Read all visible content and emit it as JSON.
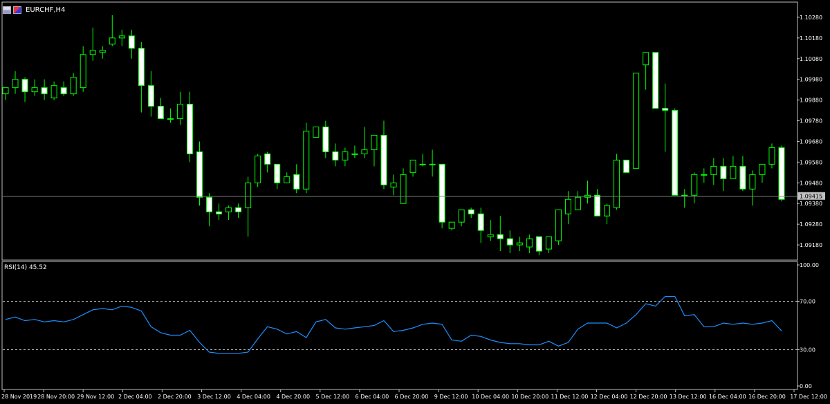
{
  "window": {
    "symbol_title": "EURCHF,H4"
  },
  "colors": {
    "background": "#000000",
    "bull_fill": "#000000",
    "bear_fill": "#ffffff",
    "wick": "#00ff00",
    "grid_border": "#c0c0c0",
    "rsi_line": "#1e90ff",
    "bid_line": "#808080"
  },
  "chart_data": [
    {
      "type": "candlestick",
      "title": "EURCHF,H4",
      "ylim": [
        1.0911,
        1.1035
      ],
      "y_ticks": [
        "1.10280",
        "1.10180",
        "1.10080",
        "1.09980",
        "1.09880",
        "1.09780",
        "1.09680",
        "1.09580",
        "1.09480",
        "1.09380",
        "1.09280",
        "1.09180"
      ],
      "current_price": "1.09415",
      "x_tick_labels": [
        "28 Nov 2019",
        "28 Nov 20:00",
        "29 Nov 12:00",
        "2 Dec 04:00",
        "2 Dec 20:00",
        "3 Dec 12:00",
        "4 Dec 04:00",
        "4 Dec 20:00",
        "5 Dec 12:00",
        "6 Dec 04:00",
        "6 Dec 20:00",
        "9 Dec 12:00",
        "10 Dec 04:00",
        "10 Dec 20:00",
        "11 Dec 12:00",
        "12 Dec 04:00",
        "12 Dec 20:00",
        "13 Dec 12:00",
        "16 Dec 04:00",
        "16 Dec 20:00",
        "17 Dec 12:00"
      ],
      "candles": [
        [
          1.0991,
          1.0994,
          1.0988,
          1.0994
        ],
        [
          1.0994,
          1.1002,
          1.0991,
          1.0998
        ],
        [
          1.0998,
          1.0999,
          1.0987,
          1.0992
        ],
        [
          1.0992,
          1.0998,
          1.099,
          1.0994
        ],
        [
          1.0994,
          1.0998,
          1.0988,
          1.0991
        ],
        [
          1.0989,
          1.0997,
          1.0988,
          1.0995
        ],
        [
          1.0994,
          1.0997,
          1.099,
          1.0991
        ],
        [
          1.0991,
          1.1001,
          1.099,
          1.0999
        ],
        [
          1.0994,
          1.1014,
          1.0992,
          1.101
        ],
        [
          1.101,
          1.1023,
          1.1007,
          1.1012
        ],
        [
          1.1011,
          1.1014,
          1.1008,
          1.1012
        ],
        [
          1.1015,
          1.1029,
          1.1014,
          1.1018
        ],
        [
          1.1018,
          1.1022,
          1.1014,
          1.1019
        ],
        [
          1.1019,
          1.1022,
          1.1008,
          1.1013
        ],
        [
          1.1013,
          1.1016,
          1.0982,
          1.0995
        ],
        [
          1.0995,
          1.1002,
          1.098,
          1.0985
        ],
        [
          1.0985,
          1.0989,
          1.098,
          1.0979
        ],
        [
          1.0979,
          1.0984,
          1.0977,
          1.0979
        ],
        [
          1.0979,
          1.0992,
          1.0976,
          1.0986
        ],
        [
          1.0986,
          1.0992,
          1.0958,
          1.0962
        ],
        [
          1.0963,
          1.0968,
          1.0937,
          1.0941
        ],
        [
          1.0941,
          1.0943,
          1.0927,
          1.0934
        ],
        [
          1.0934,
          1.0938,
          1.093,
          1.0933
        ],
        [
          1.0934,
          1.0937,
          1.093,
          1.0936
        ],
        [
          1.0936,
          1.0938,
          1.0931,
          1.0934
        ],
        [
          1.0936,
          1.0951,
          1.0922,
          1.0948
        ],
        [
          1.0948,
          1.0962,
          1.0946,
          1.0961
        ],
        [
          1.0962,
          1.0963,
          1.0953,
          1.0957
        ],
        [
          1.0957,
          1.0955,
          1.0945,
          1.0948
        ],
        [
          1.0948,
          1.0953,
          1.0948,
          1.0951
        ],
        [
          1.0952,
          1.0957,
          1.0943,
          1.0945
        ],
        [
          1.0945,
          1.0977,
          1.0943,
          1.0973
        ],
        [
          1.097,
          1.0975,
          1.097,
          1.0975
        ],
        [
          1.0975,
          1.0978,
          1.096,
          1.0963
        ],
        [
          1.0963,
          1.0967,
          1.0956,
          1.0959
        ],
        [
          1.0959,
          1.0965,
          1.0956,
          1.0963
        ],
        [
          1.0962,
          1.0966,
          1.096,
          1.0962
        ],
        [
          1.0962,
          1.0975,
          1.096,
          1.0964
        ],
        [
          1.0964,
          1.0971,
          1.0956,
          1.0971
        ],
        [
          1.0971,
          1.0978,
          1.0945,
          1.0947
        ],
        [
          1.0946,
          1.0952,
          1.0942,
          1.0948
        ],
        [
          1.0938,
          1.0955,
          1.0938,
          1.0952
        ],
        [
          1.0953,
          1.0959,
          1.0951,
          1.0959
        ],
        [
          1.0957,
          1.0962,
          1.0956,
          1.0957
        ],
        [
          1.0957,
          1.0964,
          1.0951,
          1.0957
        ],
        [
          1.0957,
          1.0957,
          1.0926,
          1.0929
        ],
        [
          1.0926,
          1.0928,
          1.0925,
          1.0929
        ],
        [
          1.0929,
          1.0934,
          1.0927,
          1.0935
        ],
        [
          1.0935,
          1.0936,
          1.0931,
          1.0933
        ],
        [
          1.0933,
          1.0936,
          1.0919,
          1.0925
        ],
        [
          1.0922,
          1.093,
          1.092,
          1.0923
        ],
        [
          1.0923,
          1.0932,
          1.0915,
          1.0921
        ],
        [
          1.0921,
          1.0925,
          1.0914,
          1.0918
        ],
        [
          1.0918,
          1.0922,
          1.0915,
          1.0919
        ],
        [
          1.0917,
          1.0923,
          1.0914,
          1.0921
        ],
        [
          1.0922,
          1.0922,
          1.0913,
          1.0915
        ],
        [
          1.0916,
          1.092,
          1.0914,
          1.0922
        ],
        [
          1.092,
          1.0935,
          1.0918,
          1.0935
        ],
        [
          1.0933,
          1.0944,
          1.0928,
          1.094
        ],
        [
          1.0935,
          1.0944,
          1.0935,
          1.0941
        ],
        [
          1.0941,
          1.0949,
          1.0938,
          1.0942
        ],
        [
          1.0942,
          1.0945,
          1.0937,
          1.0932
        ],
        [
          1.0932,
          1.0938,
          1.0928,
          1.0937
        ],
        [
          1.0936,
          1.0962,
          1.0935,
          1.0959
        ],
        [
          1.0959,
          1.0959,
          1.0954,
          1.0953
        ],
        [
          1.0955,
          1.0967,
          1.0955,
          1.1001
        ],
        [
          1.1005,
          1.1008,
          1.0993,
          1.1011
        ],
        [
          1.1011,
          1.1011,
          1.0995,
          1.0984
        ],
        [
          1.0984,
          1.0996,
          1.0963,
          1.0983
        ],
        [
          1.0983,
          1.0984,
          1.0943,
          1.0942
        ],
        [
          1.0942,
          1.0945,
          1.0936,
          1.0942
        ],
        [
          1.0942,
          1.0953,
          1.0938,
          1.0952
        ],
        [
          1.0952,
          1.0955,
          1.0948,
          1.0952
        ],
        [
          1.0952,
          1.096,
          1.0947,
          1.0956
        ],
        [
          1.0956,
          1.096,
          1.0944,
          1.095
        ],
        [
          1.095,
          1.0961,
          1.095,
          1.0956
        ],
        [
          1.0956,
          1.0961,
          1.0944,
          1.0945
        ],
        [
          1.0945,
          1.0954,
          1.0937,
          1.0952
        ],
        [
          1.0952,
          1.0955,
          1.0948,
          1.0957
        ],
        [
          1.0957,
          1.0967,
          1.0955,
          1.0965
        ],
        [
          1.0965,
          1.0966,
          1.0939,
          1.094
        ]
      ]
    },
    {
      "type": "line",
      "title": "RSI(14) 45.52",
      "ylim": [
        0,
        100
      ],
      "y_ticks": [
        "100.00",
        "70.00",
        "30.00",
        "0.00"
      ],
      "levels": [
        70,
        30
      ],
      "series": [
        {
          "values": [
            55,
            57,
            54,
            55,
            53,
            54,
            53,
            55,
            59,
            63,
            64,
            63,
            66,
            65,
            62,
            49,
            44,
            42,
            42,
            46,
            36,
            28,
            27,
            27,
            27,
            28,
            39,
            49,
            47,
            43,
            45,
            40,
            53,
            55,
            48,
            47,
            48,
            49,
            50,
            54,
            45,
            46,
            48,
            51,
            52,
            51,
            38,
            37,
            42,
            41,
            38,
            36,
            35,
            35,
            34,
            34,
            37,
            33,
            36,
            47,
            52,
            52,
            52,
            48,
            52,
            59,
            68,
            66,
            74,
            74,
            58,
            59,
            49,
            49,
            52,
            51,
            52,
            51,
            52,
            54,
            45.52
          ]
        }
      ]
    }
  ]
}
